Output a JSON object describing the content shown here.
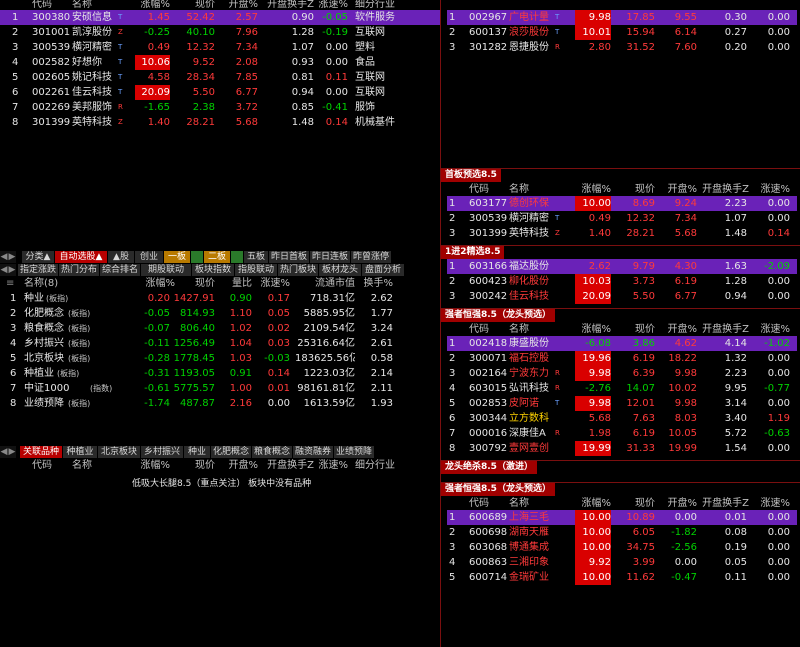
{
  "colors": {
    "red": "#ff3a3a",
    "green": "#00d200",
    "purple_selection": "#6a22b8",
    "tab_active": "#b80000"
  },
  "top_left": {
    "headers": [
      "代码",
      "名称",
      "涨幅%",
      "现价",
      "开盘%",
      "开盘换手Z",
      "涨速%",
      "细分行业"
    ],
    "rows": [
      {
        "code": "300380",
        "name": "安硕信息",
        "badge": "T",
        "change": "1.45",
        "price": "52.42",
        "open": "2.57",
        "turnover": "0.90",
        "speed": "-0.05",
        "industry": "软件服务"
      },
      {
        "code": "301001",
        "name": "凯淳股份",
        "badge": "Z",
        "change": "-0.25",
        "price": "40.10",
        "open": "7.96",
        "turnover": "1.28",
        "speed": "-0.19",
        "industry": "互联网"
      },
      {
        "code": "300539",
        "name": "横河精密",
        "badge": "T",
        "change": "0.49",
        "price": "12.32",
        "open": "7.34",
        "turnover": "1.07",
        "speed": "0.00",
        "industry": "塑料"
      },
      {
        "code": "002582",
        "name": "好想你",
        "badge": "T",
        "change": "10.06",
        "price": "9.52",
        "open": "2.08",
        "turnover": "0.93",
        "speed": "0.00",
        "industry": "食品"
      },
      {
        "code": "002605",
        "name": "姚记科技",
        "badge": "T",
        "change": "4.58",
        "price": "28.34",
        "open": "7.85",
        "turnover": "0.81",
        "speed": "0.11",
        "industry": "互联网"
      },
      {
        "code": "002261",
        "name": "佳云科技",
        "badge": "T",
        "change": "20.09",
        "price": "5.50",
        "open": "6.77",
        "turnover": "0.94",
        "speed": "0.00",
        "industry": "互联网"
      },
      {
        "code": "002269",
        "name": "美邦服饰",
        "badge": "R",
        "change": "-1.65",
        "price": "2.38",
        "open": "3.72",
        "turnover": "0.85",
        "speed": "-0.41",
        "industry": "服饰"
      },
      {
        "code": "301399",
        "name": "英特科技",
        "badge": "Z",
        "change": "1.40",
        "price": "28.21",
        "open": "5.68",
        "turnover": "1.48",
        "speed": "0.14",
        "industry": "机械基件"
      }
    ]
  },
  "tabs_row1": [
    "分类▲",
    "自动选股▲",
    "▲股",
    "创业",
    "一板",
    "",
    "二板",
    "",
    "五板",
    "昨日首板",
    "昨日连板",
    "昨曾涨停"
  ],
  "tabs_row2": [
    "指定涨跌",
    "热门分布",
    "综合排名",
    "期股联动",
    "板块指数",
    "指股联动",
    "热门板块",
    "板材龙头",
    "盘面分析"
  ],
  "sector_table": {
    "headers": [
      "名称(8)",
      "涨幅%",
      "现价",
      "量比",
      "涨速%",
      "流通市值",
      "换手%"
    ],
    "rows": [
      {
        "name": "种业",
        "tag": "(板指)",
        "change": "0.20",
        "price": "1427.91",
        "vol_ratio": "0.90",
        "speed": "0.17",
        "cap": "718.31亿",
        "turnover": "2.62"
      },
      {
        "name": "化肥概念",
        "tag": "(板指)",
        "change": "-0.05",
        "price": "814.93",
        "vol_ratio": "1.10",
        "speed": "0.05",
        "cap": "5885.95亿",
        "turnover": "1.77"
      },
      {
        "name": "粮食概念",
        "tag": "(板指)",
        "change": "-0.07",
        "price": "806.40",
        "vol_ratio": "1.02",
        "speed": "0.02",
        "cap": "2109.54亿",
        "turnover": "3.24"
      },
      {
        "name": "乡村振兴",
        "tag": "(板指)",
        "change": "-0.11",
        "price": "1256.49",
        "vol_ratio": "1.04",
        "speed": "0.03",
        "cap": "25316.64亿",
        "turnover": "2.61"
      },
      {
        "name": "北京板块",
        "tag": "(板指)",
        "change": "-0.28",
        "price": "1778.45",
        "vol_ratio": "1.03",
        "speed": "-0.03",
        "cap": "183625.56亿",
        "turnover": "0.58"
      },
      {
        "name": "种植业",
        "tag": "(板指)",
        "change": "-0.31",
        "price": "1193.05",
        "vol_ratio": "0.91",
        "speed": "0.14",
        "cap": "1223.03亿",
        "turnover": "2.14"
      },
      {
        "name": "中证1000",
        "tag": "(指数)",
        "change": "-0.61",
        "price": "5775.57",
        "vol_ratio": "1.00",
        "speed": "0.01",
        "cap": "98161.81亿",
        "turnover": "2.11"
      },
      {
        "name": "业绩预降",
        "tag": "(板指)",
        "change": "-1.74",
        "price": "487.87",
        "vol_ratio": "2.16",
        "speed": "0.00",
        "cap": "1613.59亿",
        "turnover": "1.93"
      }
    ]
  },
  "tabs_row3": [
    "关联品种",
    "种植业",
    "北京板块",
    "乡村振兴",
    "种业",
    "化肥概念",
    "粮食概念",
    "融资融券",
    "业绩预降"
  ],
  "bottom_left": {
    "headers": [
      "代码",
      "名称",
      "涨幅%",
      "现价",
      "开盘%",
      "开盘换手Z",
      "涨速%",
      "细分行业"
    ],
    "note": "低吸大长腿8.5（重点关注） 板块中没有品种"
  },
  "right_top": {
    "rows": [
      {
        "code": "002967",
        "name": "广电计量",
        "badge": "T",
        "change": "9.98",
        "price": "17.85",
        "open": "9.55",
        "turnover": "0.30",
        "speed": "0.00"
      },
      {
        "code": "600137",
        "name": "浪莎股份",
        "badge": "T",
        "change": "10.01",
        "price": "15.94",
        "open": "6.14",
        "turnover": "0.27",
        "speed": "0.00"
      },
      {
        "code": "301282",
        "name": "恩捷股份",
        "badge": "R",
        "change": "2.80",
        "price": "31.52",
        "open": "7.60",
        "turnover": "0.20",
        "speed": "0.00"
      }
    ]
  },
  "right_sections": [
    {
      "title": "首板预选8.5",
      "headers": [
        "代码",
        "名称",
        "涨幅%",
        "现价",
        "开盘%",
        "开盘换手Z",
        "涨速%"
      ],
      "rows": [
        {
          "code": "603177",
          "name": "德创环保",
          "badge": "",
          "change": "10.00",
          "price": "8.69",
          "open": "9.24",
          "turnover": "2.23",
          "speed": "0.00"
        },
        {
          "code": "300539",
          "name": "横河精密",
          "badge": "T",
          "change": "0.49",
          "price": "12.32",
          "open": "7.34",
          "turnover": "1.07",
          "speed": "0.00"
        },
        {
          "code": "301399",
          "name": "英特科技",
          "badge": "Z",
          "change": "1.40",
          "price": "28.21",
          "open": "5.68",
          "turnover": "1.48",
          "speed": "0.14"
        }
      ]
    },
    {
      "title": "1进2精选8.5",
      "headers": [],
      "rows": [
        {
          "code": "603166",
          "name": "福达股份",
          "badge": "",
          "change": "2.62",
          "price": "9.79",
          "open": "4.30",
          "turnover": "1.63",
          "speed": "-2.09"
        },
        {
          "code": "600423",
          "name": "柳化股份",
          "badge": "",
          "change": "10.03",
          "price": "3.73",
          "open": "6.19",
          "turnover": "1.28",
          "speed": "0.00"
        },
        {
          "code": "300242",
          "name": "佳云科技",
          "badge": "",
          "change": "20.09",
          "price": "5.50",
          "open": "6.77",
          "turnover": "0.94",
          "speed": "0.00"
        }
      ]
    },
    {
      "title": "强者恒强8.5（龙头预选）",
      "headers": [
        "代码",
        "名称",
        "涨幅%",
        "现价",
        "开盘%",
        "开盘换手Z",
        "涨速%"
      ],
      "rows": [
        {
          "code": "002418",
          "name": "康盛股份",
          "badge": "",
          "change": "-6.08",
          "price": "3.86",
          "open": "4.62",
          "turnover": "4.14",
          "speed": "-1.02"
        },
        {
          "code": "300071",
          "name": "福石控股",
          "badge": "",
          "change": "19.96",
          "price": "6.19",
          "open": "18.22",
          "turnover": "1.32",
          "speed": "0.00"
        },
        {
          "code": "002164",
          "name": "宁波东力",
          "badge": "R",
          "change": "9.98",
          "price": "6.39",
          "open": "9.98",
          "turnover": "2.23",
          "speed": "0.00"
        },
        {
          "code": "603015",
          "name": "弘讯科技",
          "badge": "R",
          "change": "-2.76",
          "price": "14.07",
          "open": "10.02",
          "turnover": "9.95",
          "speed": "-0.77"
        },
        {
          "code": "002853",
          "name": "皮阿诺",
          "badge": "T",
          "change": "9.98",
          "price": "12.01",
          "open": "9.98",
          "turnover": "3.14",
          "speed": "0.00"
        },
        {
          "code": "300344",
          "name": "立方数科",
          "badge": "",
          "change": "5.68",
          "price": "7.63",
          "open": "8.03",
          "turnover": "3.40",
          "speed": "1.19"
        },
        {
          "code": "000016",
          "name": "深康佳A",
          "badge": "R",
          "change": "1.98",
          "price": "6.19",
          "open": "10.05",
          "turnover": "5.72",
          "speed": "-0.63"
        },
        {
          "code": "300792",
          "name": "壹网壹创",
          "badge": "",
          "change": "19.99",
          "price": "31.33",
          "open": "19.99",
          "turnover": "1.54",
          "speed": "0.00"
        }
      ]
    },
    {
      "title": "龙头绝杀8.5（激进）",
      "headers": [],
      "rows": []
    },
    {
      "title": "强者恒强8.5（龙头预选）",
      "headers": [
        "代码",
        "名称",
        "涨幅%",
        "现价",
        "开盘%",
        "开盘换手Z",
        "涨速%"
      ],
      "rows": [
        {
          "code": "600689",
          "name": "上海三毛",
          "badge": "",
          "change": "10.00",
          "price": "10.89",
          "open": "0.00",
          "turnover": "0.01",
          "speed": "0.00"
        },
        {
          "code": "600698",
          "name": "湖南天雁",
          "badge": "",
          "change": "10.00",
          "price": "6.05",
          "open": "-1.82",
          "turnover": "0.08",
          "speed": "0.00"
        },
        {
          "code": "603068",
          "name": "博通集成",
          "badge": "",
          "change": "10.00",
          "price": "34.75",
          "open": "-2.56",
          "turnover": "0.19",
          "speed": "0.00"
        },
        {
          "code": "600863",
          "name": "三湘印象",
          "badge": "",
          "change": "9.92",
          "price": "3.99",
          "open": "0.00",
          "turnover": "0.05",
          "speed": "0.00"
        },
        {
          "code": "600714",
          "name": "金瑞矿业",
          "badge": "",
          "change": "10.00",
          "price": "11.62",
          "open": "-0.47",
          "turnover": "0.11",
          "speed": "0.00"
        }
      ]
    }
  ]
}
